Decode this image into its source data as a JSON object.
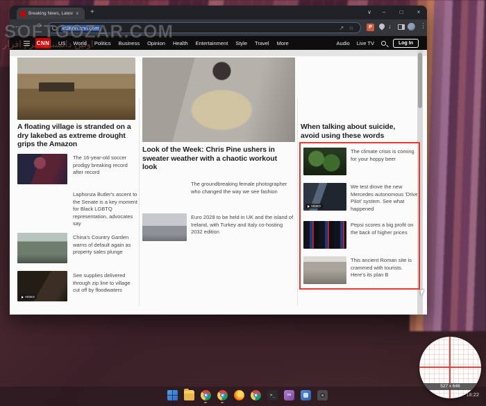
{
  "colors": {
    "cnn_red": "#cc0000",
    "selection_red": "#e8372c",
    "url_selection_blue": "#2f5a9e",
    "extension_badge_orange": "#cf5b3f"
  },
  "icons": {
    "back": "←",
    "forward": "→",
    "reload": "⟳",
    "tab_close": "×",
    "new_tab": "+",
    "chevron_down": "∨",
    "minimize": "–",
    "maximize": "□",
    "close": "×",
    "menu_dots": "⋮",
    "share": "↗",
    "star": "☆",
    "download": "↓",
    "extension_p": "P",
    "terminal_prompt": ">_",
    "vs_glyph": "∞"
  },
  "watermark": {
    "main": "SOFTGOZAR.COM",
    "sub": "اولین دانشنامه نرم افزار"
  },
  "browser": {
    "tab_title": "Breaking News, Latest News an...",
    "url": "edition.cnn.com"
  },
  "cnn": {
    "logo": "CNN",
    "menu": [
      "US",
      "World",
      "Politics",
      "Business",
      "Opinion",
      "Health",
      "Entertainment",
      "Style",
      "Travel",
      "More"
    ],
    "audio": "Audio",
    "live_tv": "Live TV",
    "login": "Log In"
  },
  "page": {
    "video_badge": "VIDEO",
    "left": {
      "headline": "A floating village is stranded on a dry lakebed as extreme drought grips the Amazon",
      "items": [
        {
          "text": "The 16-year-old soccer prodigy breaking record after record"
        },
        {
          "text": "Laphonza Butler's ascent to the Senate is a key moment for Black LGBTQ representation, advocates say"
        },
        {
          "text": "China's Country Garden warns of default again as property sales plunge"
        },
        {
          "text": "See supplies delivered through zip line to village cut off by floodwaters"
        }
      ]
    },
    "middle": {
      "headline": "Look of the Week: Chris Pine ushers in sweater weather with a chaotic workout look",
      "items": [
        {
          "text": "The groundbreaking female photographer who changed the way we see fashion"
        },
        {
          "text": "Euro 2028 to be held in UK and the island of Ireland, with Turkey and Italy co-hosting 2032 edition"
        }
      ]
    },
    "right": {
      "headline": "When talking about suicide, avoid using these words",
      "items": [
        {
          "text": "The climate crisis is coming for your hoppy beer"
        },
        {
          "text": "We test drove the new Mercedes autonomous 'Drive Pilot' system. See what happened"
        },
        {
          "text": "Pepsi scores a big profit on the back of higher prices"
        },
        {
          "text": "This ancient Roman site is crammed with tourists. Here's its plan B"
        }
      ]
    }
  },
  "snip": {
    "size_label": "527 x 646"
  },
  "taskbar": {
    "clock": "18:22"
  }
}
